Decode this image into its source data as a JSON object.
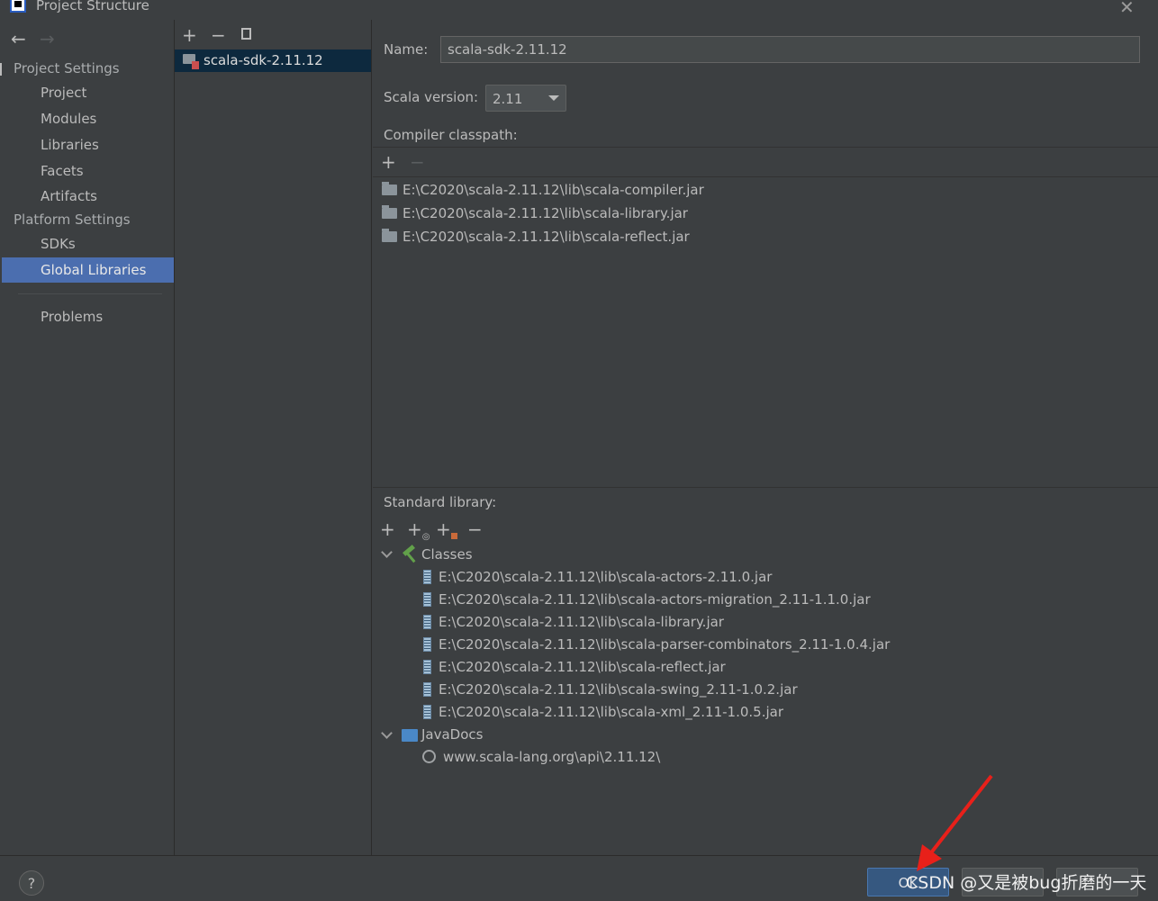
{
  "window": {
    "title": "Project Structure"
  },
  "nav": {
    "project_settings_heading": "Project Settings",
    "platform_settings_heading": "Platform Settings",
    "items": {
      "project": "Project",
      "modules": "Modules",
      "libraries": "Libraries",
      "facets": "Facets",
      "artifacts": "Artifacts",
      "sdks": "SDKs",
      "global_libraries": "Global Libraries",
      "problems": "Problems"
    },
    "selected": "global_libraries"
  },
  "middle": {
    "toolbar": {
      "add": "+",
      "remove": "−"
    },
    "library": "scala-sdk-2.11.12"
  },
  "details": {
    "name_label": "Name:",
    "name_value": "scala-sdk-2.11.12",
    "scala_version_label": "Scala version:",
    "scala_version_value": "2.11",
    "compiler_classpath_label": "Compiler classpath:",
    "compiler_classpath": [
      "E:\\C2020\\scala-2.11.12\\lib\\scala-compiler.jar",
      "E:\\C2020\\scala-2.11.12\\lib\\scala-library.jar",
      "E:\\C2020\\scala-2.11.12\\lib\\scala-reflect.jar"
    ],
    "standard_library_label": "Standard library:",
    "classes_label": "Classes",
    "classes": [
      "E:\\C2020\\scala-2.11.12\\lib\\scala-actors-2.11.0.jar",
      "E:\\C2020\\scala-2.11.12\\lib\\scala-actors-migration_2.11-1.1.0.jar",
      "E:\\C2020\\scala-2.11.12\\lib\\scala-library.jar",
      "E:\\C2020\\scala-2.11.12\\lib\\scala-parser-combinators_2.11-1.0.4.jar",
      "E:\\C2020\\scala-2.11.12\\lib\\scala-reflect.jar",
      "E:\\C2020\\scala-2.11.12\\lib\\scala-swing_2.11-1.0.2.jar",
      "E:\\C2020\\scala-2.11.12\\lib\\scala-xml_2.11-1.0.5.jar"
    ],
    "javadocs_label": "JavaDocs",
    "javadocs": [
      "www.scala-lang.org\\api\\2.11.12\\"
    ]
  },
  "bottom": {
    "help": "?",
    "ok": "OK",
    "watermark": "CSDN @又是被bug折磨的一天"
  },
  "colors": {
    "background": "#3c3f41",
    "selection": "#4b6eaf",
    "ok_button": "#365880",
    "annotation_arrow": "#e8201a"
  }
}
